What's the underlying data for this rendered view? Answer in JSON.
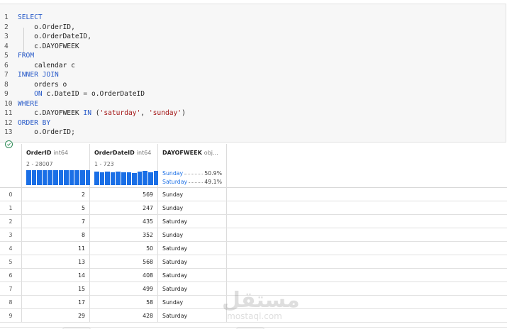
{
  "code": {
    "lines": [
      {
        "n": "1",
        "parts": [
          {
            "t": "SELECT",
            "k": "kw"
          }
        ]
      },
      {
        "n": "2",
        "parts": [
          {
            "t": "    o.OrderID,",
            "k": "code-text"
          }
        ]
      },
      {
        "n": "3",
        "parts": [
          {
            "t": "    o.OrderDateID,",
            "k": "code-text"
          }
        ]
      },
      {
        "n": "4",
        "parts": [
          {
            "t": "    c.DAYOFWEEK",
            "k": "code-text"
          }
        ]
      },
      {
        "n": "5",
        "parts": [
          {
            "t": "FROM",
            "k": "kw"
          }
        ]
      },
      {
        "n": "6",
        "parts": [
          {
            "t": "    calendar c",
            "k": "code-text"
          }
        ]
      },
      {
        "n": "7",
        "parts": [
          {
            "t": "INNER JOIN",
            "k": "kw"
          }
        ]
      },
      {
        "n": "8",
        "parts": [
          {
            "t": "    orders o",
            "k": "code-text"
          }
        ]
      },
      {
        "n": "9",
        "parts": [
          {
            "t": "    ON",
            "k": "kw"
          },
          {
            "t": " c.DateID ",
            "k": "code-text"
          },
          {
            "t": "=",
            "k": "op"
          },
          {
            "t": " o.OrderDateID",
            "k": "code-text"
          }
        ]
      },
      {
        "n": "10",
        "parts": [
          {
            "t": "WHERE",
            "k": "kw"
          }
        ]
      },
      {
        "n": "11",
        "parts": [
          {
            "t": "    c.DAYOFWEEK ",
            "k": "code-text"
          },
          {
            "t": "IN",
            "k": "kw"
          },
          {
            "t": " (",
            "k": "code-text"
          },
          {
            "t": "'saturday'",
            "k": "str"
          },
          {
            "t": ", ",
            "k": "code-text"
          },
          {
            "t": "'sunday'",
            "k": "str"
          },
          {
            "t": ")",
            "k": "code-text"
          }
        ]
      },
      {
        "n": "12",
        "parts": [
          {
            "t": "ORDER BY",
            "k": "kw"
          }
        ]
      },
      {
        "n": "13",
        "parts": [
          {
            "t": "    o.OrderID;",
            "k": "code-text"
          }
        ]
      }
    ]
  },
  "table": {
    "columns": [
      {
        "name": "OrderID",
        "type": "int64",
        "range": "2 - 28007",
        "hist": [
          1,
          1,
          1,
          1,
          1,
          1,
          1,
          1,
          1,
          1,
          1,
          1
        ]
      },
      {
        "name": "OrderDateID",
        "type": "int64",
        "range": "1 - 723",
        "hist": [
          0.92,
          0.86,
          0.9,
          0.88,
          0.92,
          0.86,
          0.88,
          0.82,
          0.9,
          0.94,
          0.88,
          0.95
        ]
      },
      {
        "name": "DAYOFWEEK",
        "type": "obj...",
        "categories": [
          {
            "name": "Sunday",
            "pct": "50.9%"
          },
          {
            "name": "Saturday",
            "pct": "49.1%"
          }
        ]
      }
    ],
    "rows": [
      {
        "idx": "0",
        "order_id": "2",
        "order_date_id": "569",
        "day": "Sunday"
      },
      {
        "idx": "1",
        "order_id": "5",
        "order_date_id": "247",
        "day": "Sunday"
      },
      {
        "idx": "2",
        "order_id": "7",
        "order_date_id": "435",
        "day": "Saturday"
      },
      {
        "idx": "3",
        "order_id": "8",
        "order_date_id": "352",
        "day": "Sunday"
      },
      {
        "idx": "4",
        "order_id": "11",
        "order_date_id": "50",
        "day": "Saturday"
      },
      {
        "idx": "5",
        "order_id": "13",
        "order_date_id": "568",
        "day": "Saturday"
      },
      {
        "idx": "6",
        "order_id": "14",
        "order_date_id": "408",
        "day": "Saturday"
      },
      {
        "idx": "7",
        "order_id": "15",
        "order_date_id": "499",
        "day": "Saturday"
      },
      {
        "idx": "8",
        "order_id": "17",
        "order_date_id": "58",
        "day": "Sunday"
      },
      {
        "idx": "9",
        "order_id": "29",
        "order_date_id": "428",
        "day": "Saturday"
      }
    ]
  },
  "status": {
    "icon": "check-circle-icon",
    "color": "#2e8b57"
  },
  "watermark": {
    "logo_text": "مستقل",
    "site": "mostaql.com"
  },
  "colors": {
    "keyword": "#2558c8",
    "string": "#a31515",
    "histogram": "#1a6fe6"
  }
}
